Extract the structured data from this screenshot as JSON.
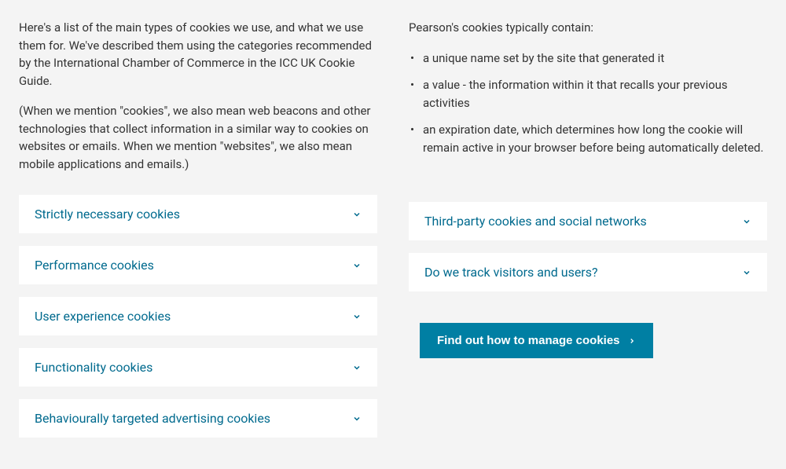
{
  "left": {
    "p1": "Here's a list of the main types of cookies we use, and what we use them for. We've described them using the categories recommended by the International Chamber of Commerce in the ICC UK Cookie Guide.",
    "p2": "(When we mention \"cookies\", we also mean web beacons and other technologies that collect information in a similar way to cookies on websites or emails. When we mention \"websites\", we also mean mobile applications and emails.)",
    "accordions": [
      "Strictly necessary cookies",
      "Performance cookies",
      "User experience cookies",
      "Functionality cookies",
      "Behaviourally targeted advertising cookies"
    ]
  },
  "right": {
    "lead": "Pearson's cookies typically contain:",
    "bullets": [
      "a unique name set by the site that generated it",
      "a value - the information within it that recalls your previous activities",
      "an expiration date, which determines how long the cookie will remain active in your browser before being automatically deleted."
    ],
    "accordions": [
      "Third-party cookies and social networks",
      "Do we track visitors and users?"
    ],
    "cta_label": "Find out how to manage cookies"
  },
  "colors": {
    "accent": "#007fa3",
    "link": "#006a8e",
    "bg": "#f4f4f4"
  }
}
